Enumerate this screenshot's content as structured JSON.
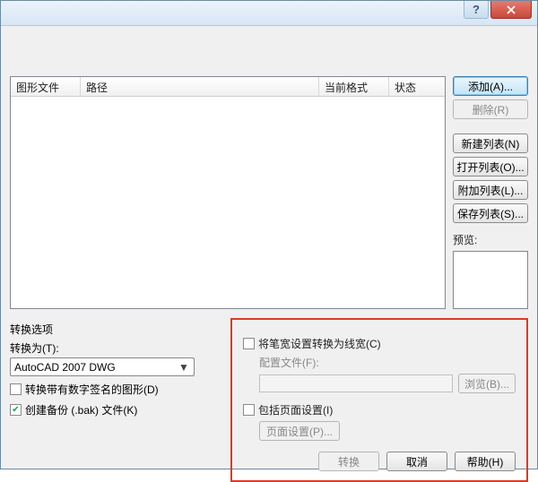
{
  "titlebar": {
    "help_tooltip": "?",
    "close_tooltip": "关闭"
  },
  "table": {
    "headers": {
      "file": "图形文件",
      "path": "路径",
      "format": "当前格式",
      "status": "状态"
    }
  },
  "sidebar": {
    "add": "添加(A)...",
    "remove": "删除(R)",
    "new_list": "新建列表(N)",
    "open_list": "打开列表(O)...",
    "append_list": "附加列表(L)...",
    "save_list": "保存列表(S)...",
    "preview_label": "预览:"
  },
  "convert": {
    "group_title": "转换选项",
    "to_label": "转换为(T):",
    "to_value": "AutoCAD 2007 DWG",
    "chk_signed": "转换带有数字签名的图形(D)",
    "chk_backup": "创建备份 (.bak) 文件(K)"
  },
  "redbox": {
    "chk_penwidth": "将笔宽设置转换为线宽(C)",
    "cfg_label": "配置文件(F):",
    "browse": "浏览(B)...",
    "chk_pagesetup": "包括页面设置(I)",
    "pagesetup_btn": "页面设置(P)...",
    "convert_btn": "转换",
    "cancel_btn": "取消",
    "help_btn": "帮助(H)"
  }
}
